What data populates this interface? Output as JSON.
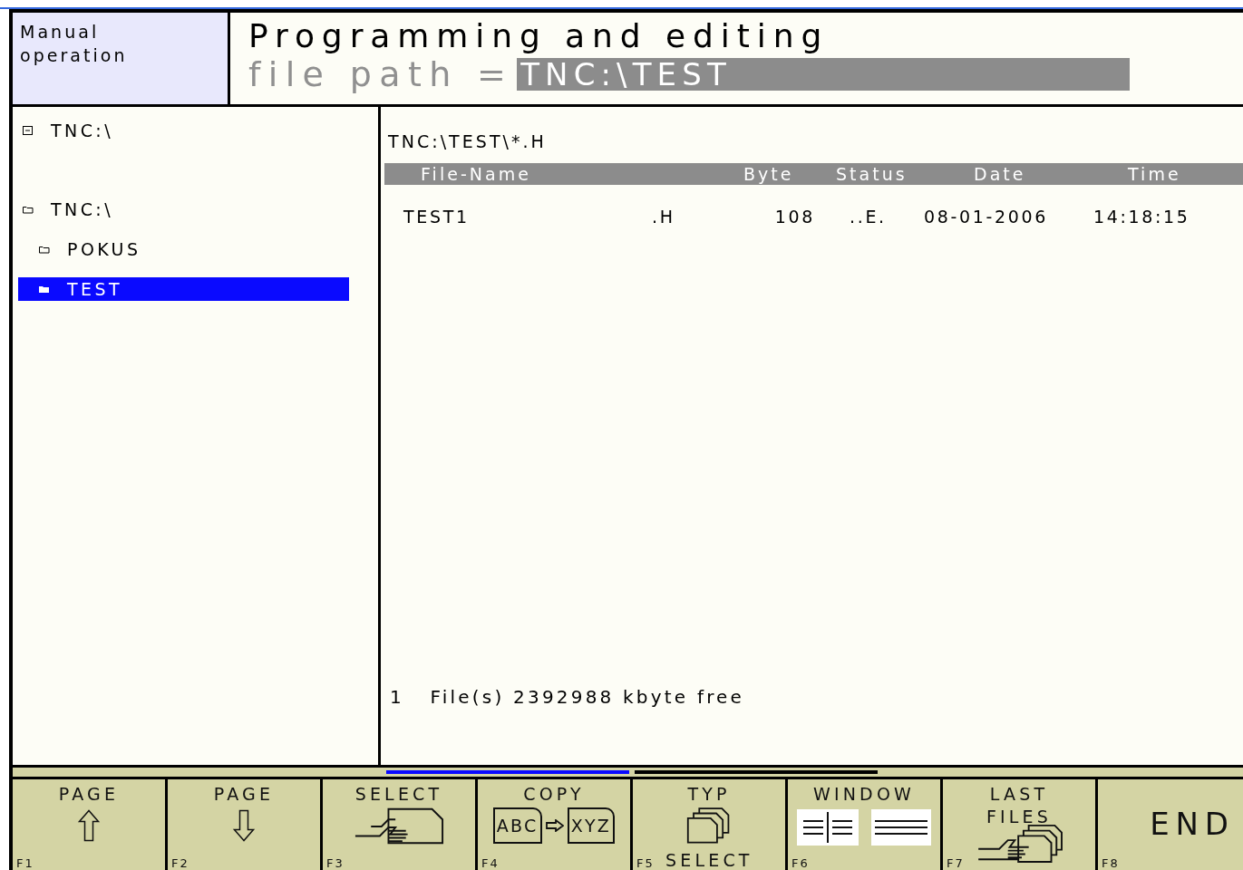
{
  "header": {
    "mode": [
      "Manual",
      "operation"
    ],
    "title": "Programming and editing",
    "path_label": "file path =",
    "path_value": "TNC:\\TEST"
  },
  "drives": [
    {
      "label": "TNC:\\",
      "kind": "drive"
    }
  ],
  "tree": [
    {
      "label": "TNC:\\",
      "selected": false,
      "children": [
        {
          "label": "POKUS",
          "selected": false
        },
        {
          "label": "TEST",
          "selected": true
        }
      ]
    }
  ],
  "files": {
    "filter": "TNC:\\TEST\\*.H",
    "columns": [
      "File-Name",
      "Byte",
      "Status",
      "Date",
      "Time"
    ],
    "rows": [
      {
        "name": "TEST1",
        "ext": ".H",
        "byte": "108",
        "status": "..E.",
        "date": "08-01-2006",
        "time": "14:18:15"
      }
    ],
    "summary": "1   File(s) 2392988 kbyte free"
  },
  "softkey_pages": [
    {
      "selected": true
    },
    {
      "selected": false
    }
  ],
  "softkeys": [
    {
      "label": [
        "PAGE"
      ],
      "kind": "up",
      "key": "F1"
    },
    {
      "label": [
        "PAGE"
      ],
      "kind": "down",
      "key": "F2"
    },
    {
      "label": [
        "SELECT"
      ],
      "kind": "select",
      "key": "F3"
    },
    {
      "label": [
        "COPY"
      ],
      "kind": "copy",
      "key": "F4",
      "icon_text": [
        "ABC",
        "XYZ"
      ]
    },
    {
      "label": [
        "TYP"
      ],
      "kind": "typ",
      "key": "F5",
      "bottom": "SELECT"
    },
    {
      "label": [
        "WINDOW"
      ],
      "kind": "window",
      "key": "F6"
    },
    {
      "label": [
        "LAST",
        "FILES"
      ],
      "kind": "last",
      "key": "F7"
    },
    {
      "label": [
        "END"
      ],
      "kind": "big",
      "key": "F8"
    }
  ]
}
